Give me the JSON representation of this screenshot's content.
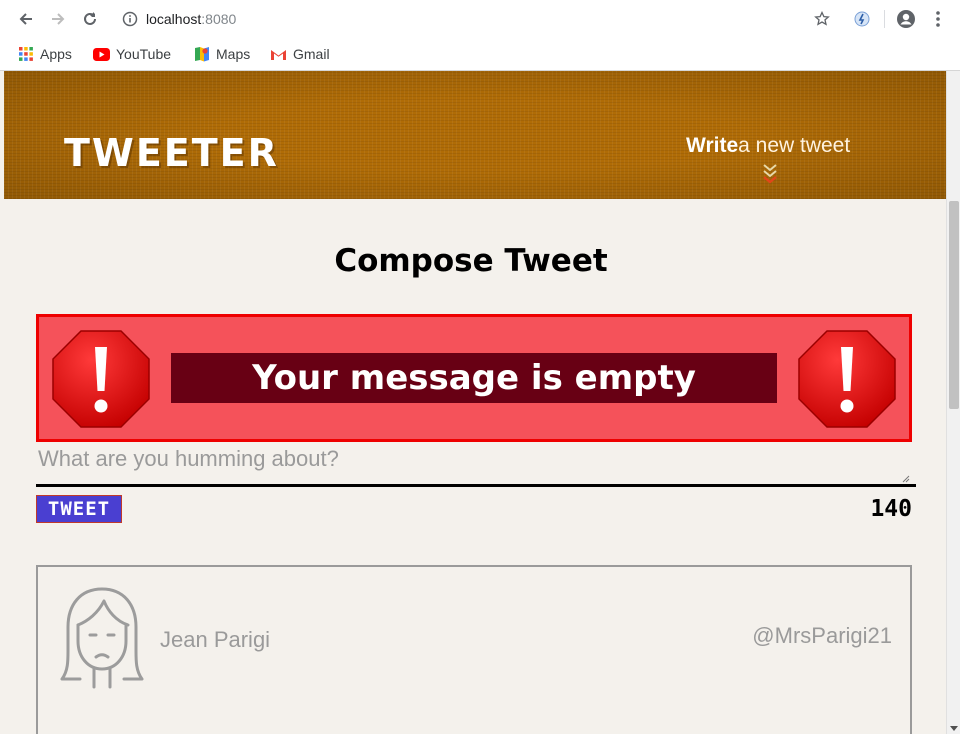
{
  "browser": {
    "url_host": "localhost",
    "url_port": ":8080",
    "bookmarks": [
      {
        "label": "Apps",
        "icon": "apps-grid-icon"
      },
      {
        "label": "YouTube",
        "icon": "youtube-icon"
      },
      {
        "label": "Maps",
        "icon": "maps-icon"
      },
      {
        "label": "Gmail",
        "icon": "gmail-icon"
      }
    ]
  },
  "header": {
    "logo": "TWEETER",
    "write_bold": "Write",
    "write_rest": "a new tweet"
  },
  "compose": {
    "title": "Compose Tweet",
    "error_message": "Your message is empty",
    "placeholder": "What are you humming about?",
    "value": "",
    "button_label": "TWEET",
    "counter": "140"
  },
  "tweet": {
    "name": "Jean Parigi",
    "handle": "@MrsParigi21"
  },
  "colors": {
    "header_bg": "#b06c06",
    "error_bg": "#f5525a",
    "error_border": "#ee0000",
    "error_msg_bg": "#680014",
    "tweet_button": "#4a3fd1",
    "page_bg": "#f4f1ec"
  }
}
